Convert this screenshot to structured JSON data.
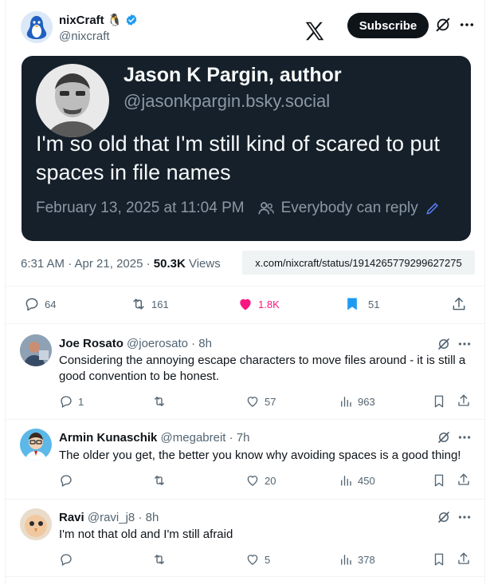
{
  "author": {
    "name": "nixCraft",
    "emoji": "🐧",
    "handle": "@nixcraft",
    "subscribe_label": "Subscribe"
  },
  "card": {
    "name": "Jason K Pargin, author",
    "handle": "@jasonkpargin.bsky.social",
    "text": "I'm so old that I'm still kind of scared to put spaces in file names",
    "date": "February 13, 2025 at 11:04 PM",
    "audience": "Everybody can reply"
  },
  "meta": {
    "time": "6:31 AM · Apr 21, 2025 · ",
    "views": "50.3K",
    "views_label": " Views",
    "url": "x.com/nixcraft/status/1914265779299627275"
  },
  "actions": {
    "replies": "64",
    "reposts": "161",
    "likes": "1.8K",
    "bookmarks": "51"
  },
  "colors": {
    "like": "#f91880",
    "bookmark": "#1d9bf0",
    "card_bg": "#15202b"
  },
  "replies": [
    {
      "name": "Joe Rosato",
      "handle": "@joerosato · 8h",
      "text": "Considering the annoying escape characters to move files around - it is still a good convention to be honest.",
      "reply_count": "1",
      "repost_count": "",
      "like_count": "57",
      "view_count": "963"
    },
    {
      "name": "Armin Kunaschik",
      "handle": "@megabreit · 7h",
      "text": "The older you get, the better you know why avoiding spaces is a good thing!",
      "reply_count": "",
      "repost_count": "",
      "like_count": "20",
      "view_count": "450"
    },
    {
      "name": "Ravi",
      "handle": "@ravi_j8 · 8h",
      "text": "I'm not that old and I'm still afraid",
      "reply_count": "",
      "repost_count": "",
      "like_count": "5",
      "view_count": "378"
    }
  ]
}
